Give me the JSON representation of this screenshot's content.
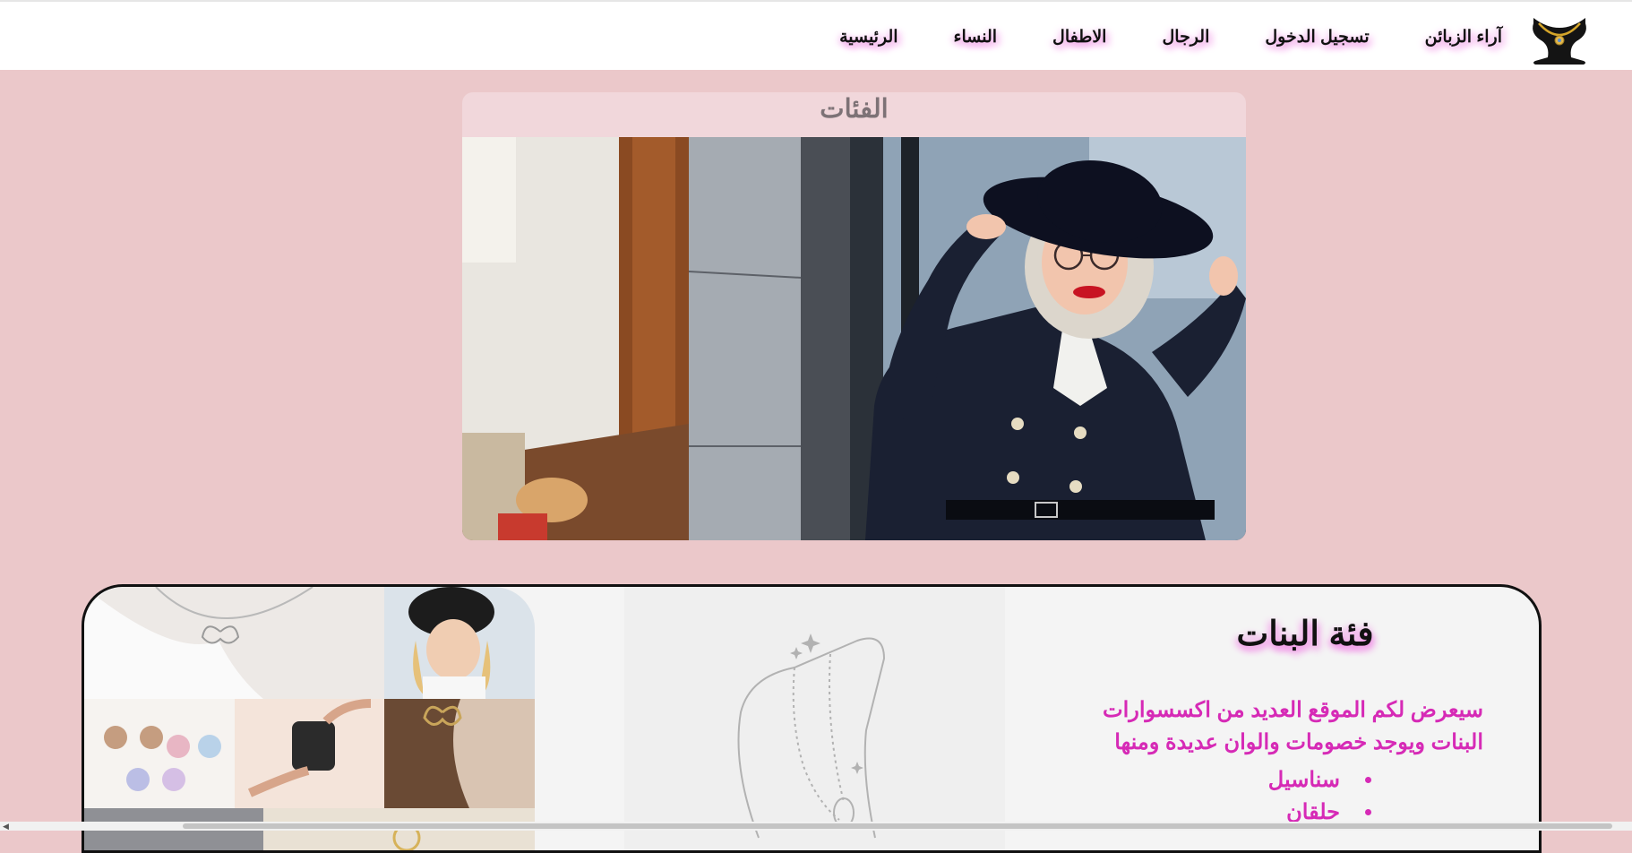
{
  "nav": {
    "logo_alt": "necklace-bust-logo",
    "items": [
      {
        "label": "الرئيسية"
      },
      {
        "label": "النساء"
      },
      {
        "label": "الاطفال"
      },
      {
        "label": "الرجال"
      },
      {
        "label": "تسجيل الدخول"
      },
      {
        "label": "آراء الزبائن"
      }
    ]
  },
  "categories": {
    "title": "الفئات"
  },
  "girls_section": {
    "title": "فئة البنات",
    "description": "سيعرض لكم الموقع العديد من اكسسوارات البنات ويوجد خصومات والوان عديدة ومنها",
    "list": [
      {
        "label": "سناسيل"
      },
      {
        "label": "حلقان"
      }
    ]
  },
  "colors": {
    "page_bg": "#ebc8ca",
    "accent_pink": "#d62ab6",
    "card_bg": "#f1d7db"
  }
}
